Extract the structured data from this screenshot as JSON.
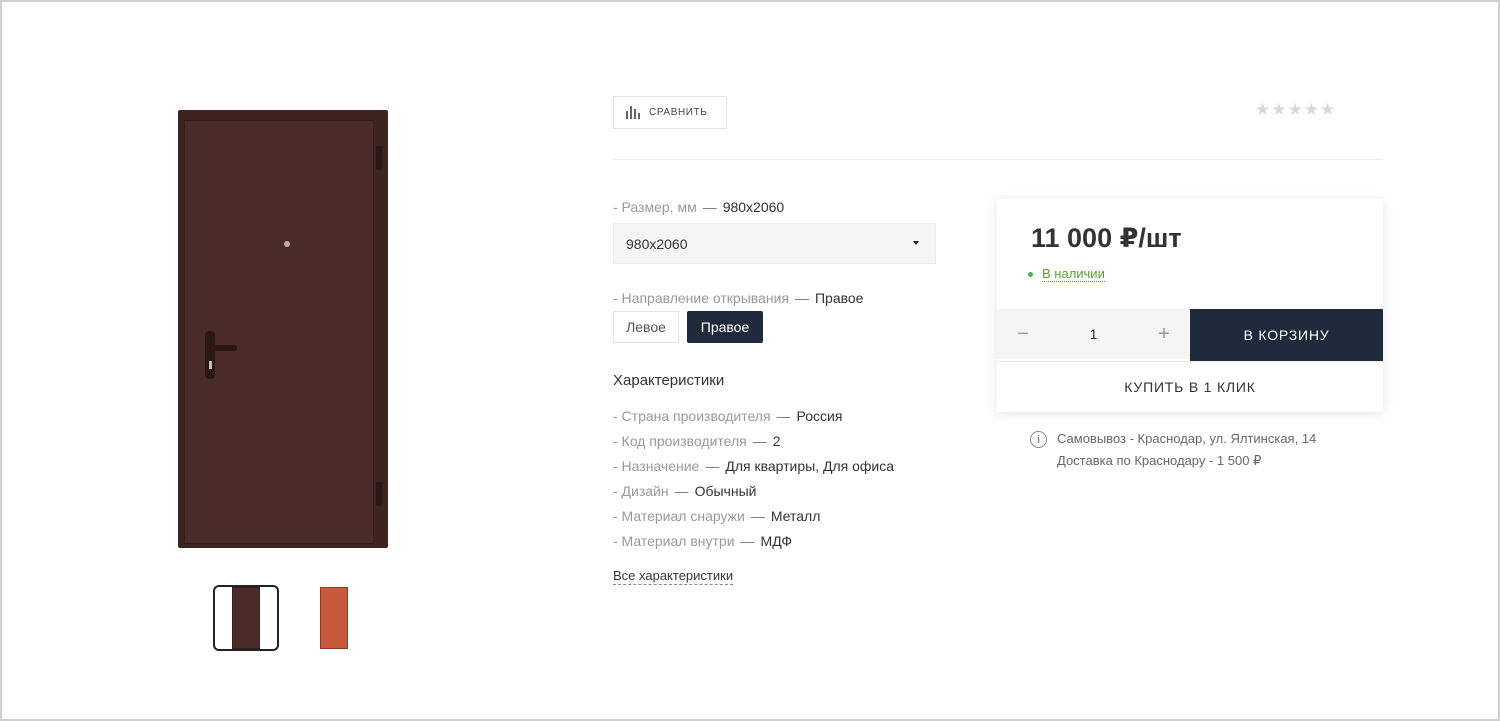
{
  "gallery": {
    "thumbs": [
      {
        "name": "brown-door-thumb",
        "active": true
      },
      {
        "name": "orange-door-thumb",
        "active": false
      }
    ]
  },
  "toolbar": {
    "compare_label": "СРАВНИТЬ",
    "stars": "★★★★★"
  },
  "options": {
    "size": {
      "label": "- Размер, мм",
      "sep": "—",
      "value": "980x2060",
      "selected": "980x2060"
    },
    "direction": {
      "label": "- Направление открывания",
      "sep": "—",
      "value": "Правое",
      "btn_left": "Левое",
      "btn_right": "Правое"
    }
  },
  "characteristics": {
    "title": "Характеристики",
    "items": [
      {
        "label": "- Страна производителя",
        "value": "Россия"
      },
      {
        "label": "- Код производителя",
        "value": "2"
      },
      {
        "label": "- Назначение",
        "value": "Для квартиры, Для офиса"
      },
      {
        "label": "- Дизайн",
        "value": "Обычный"
      },
      {
        "label": "- Материал снаружи",
        "value": "Металл"
      },
      {
        "label": "- Материал внутри",
        "value": "МДФ"
      }
    ],
    "sep": "—",
    "all_link": "Все характеристики"
  },
  "buy": {
    "price": "11 000 ₽/шт",
    "stock": "В наличии",
    "qty_minus": "−",
    "qty": "1",
    "qty_plus": "+",
    "cart_label": "В КОРЗИНУ",
    "oneclick_label": "КУПИТЬ В 1 КЛИК"
  },
  "delivery": {
    "info_icon": "i",
    "pickup": "Самовывоз - Краснодар, ул. Ялтинская, 14",
    "courier": "Доставка по Краснодару - 1 500 ₽"
  },
  "colors": {
    "accent_dark": "#1f2a3c",
    "in_stock": "#5aa02c",
    "door_brown": "#4a2b27",
    "door_orange": "#c8593a"
  }
}
